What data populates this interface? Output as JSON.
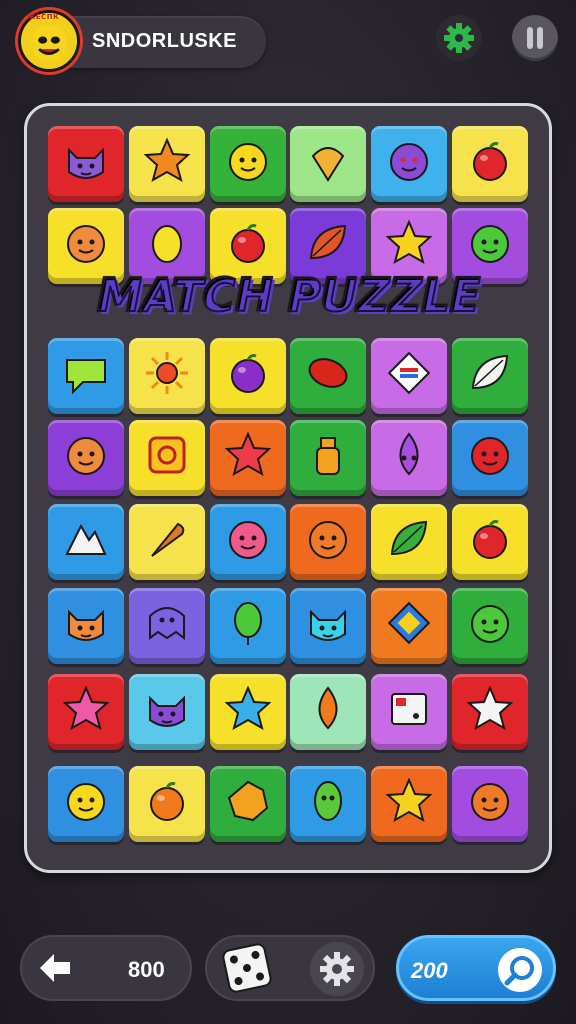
{
  "header": {
    "player_name": "SNDORLUSKE",
    "avatar_text": "ЖЁСПК",
    "icons": {
      "settings": "gear-icon",
      "pause": "pause-icon"
    },
    "colors": {
      "settings": "#2fb84a",
      "pause": "#c8c8cc",
      "avatar_ring": "#e03a2a"
    }
  },
  "board": {
    "title": "MATCH PUZZLE",
    "rows": [
      [
        {
          "color": "#e0262a",
          "icon": "cat-face"
        },
        {
          "color": "#f6e34c",
          "icon": "orange-star"
        },
        {
          "color": "#35b23a",
          "icon": "lemon-face"
        },
        {
          "color": "#9ee68a",
          "icon": "shell"
        },
        {
          "color": "#3fb2ee",
          "icon": "purple-mask"
        },
        {
          "color": "#f6e34c",
          "icon": "tomato"
        }
      ],
      [
        {
          "color": "#f6e02a",
          "icon": "bear-face"
        },
        {
          "color": "#a24de0",
          "icon": "lemon"
        },
        {
          "color": "#f6e02a",
          "icon": "apple"
        },
        {
          "color": "#7a3bd8",
          "icon": "leaf"
        },
        {
          "color": "#c86be6",
          "icon": "yellow-star"
        },
        {
          "color": "#a24de0",
          "icon": "green-face"
        }
      ],
      [
        {
          "color": "#2f9be6",
          "icon": "speech-bubble"
        },
        {
          "color": "#f6e34c",
          "icon": "sun"
        },
        {
          "color": "#f6e02a",
          "icon": "plum"
        },
        {
          "color": "#2fae3e",
          "icon": "red-bean"
        },
        {
          "color": "#c86be6",
          "icon": "flag-diamond"
        },
        {
          "color": "#2fae3e",
          "icon": "white-leaf"
        }
      ],
      [
        {
          "color": "#8d3ed6",
          "icon": "bear-face"
        },
        {
          "color": "#f6e02a",
          "icon": "yellow-block"
        },
        {
          "color": "#ef6a1f",
          "icon": "red-star"
        },
        {
          "color": "#2fae3e",
          "icon": "honey-jar"
        },
        {
          "color": "#c86be6",
          "icon": "drop-face"
        },
        {
          "color": "#2f8fe0",
          "icon": "tomato-face"
        }
      ],
      [
        {
          "color": "#2f9be6",
          "icon": "white-shape"
        },
        {
          "color": "#f6e34c",
          "icon": "carrot"
        },
        {
          "color": "#2f9be6",
          "icon": "pink-face"
        },
        {
          "color": "#ef6a1f",
          "icon": "orange-face"
        },
        {
          "color": "#f6e02a",
          "icon": "green-leaf"
        },
        {
          "color": "#f6e02a",
          "icon": "cherry"
        }
      ],
      [
        {
          "color": "#2f8fe0",
          "icon": "fox-face"
        },
        {
          "color": "#7a62e0",
          "icon": "ghost"
        },
        {
          "color": "#2f9be6",
          "icon": "green-balloon"
        },
        {
          "color": "#2f8fe0",
          "icon": "cyan-cat"
        },
        {
          "color": "#ef7a1f",
          "icon": "blue-diamond"
        },
        {
          "color": "#2fae3e",
          "icon": "green-face"
        }
      ],
      [
        {
          "color": "#e0262a",
          "icon": "pink-star"
        },
        {
          "color": "#5ac8e8",
          "icon": "purple-cat"
        },
        {
          "color": "#f6e02a",
          "icon": "blue-star"
        },
        {
          "color": "#9ee6b8",
          "icon": "orange-drop"
        },
        {
          "color": "#c86be6",
          "icon": "card"
        },
        {
          "color": "#e0262a",
          "icon": "white-star"
        }
      ],
      [
        {
          "color": "#2f8fe0",
          "icon": "lemon-face"
        },
        {
          "color": "#f6e34c",
          "icon": "orange-fruit"
        },
        {
          "color": "#2fae3e",
          "icon": "leaf-star"
        },
        {
          "color": "#2f9be6",
          "icon": "green-bean"
        },
        {
          "color": "#ef6a1f",
          "icon": "yellow-star"
        },
        {
          "color": "#a24de0",
          "icon": "orange-face"
        }
      ]
    ]
  },
  "footer": {
    "score": "800",
    "moves": "200",
    "icons": {
      "back": "arrow-left-icon",
      "dice": "dice-icon",
      "gear": "gear-icon",
      "hint": "magnifier-icon"
    },
    "colors": {
      "moves_pill": "#2a8fe0"
    }
  }
}
